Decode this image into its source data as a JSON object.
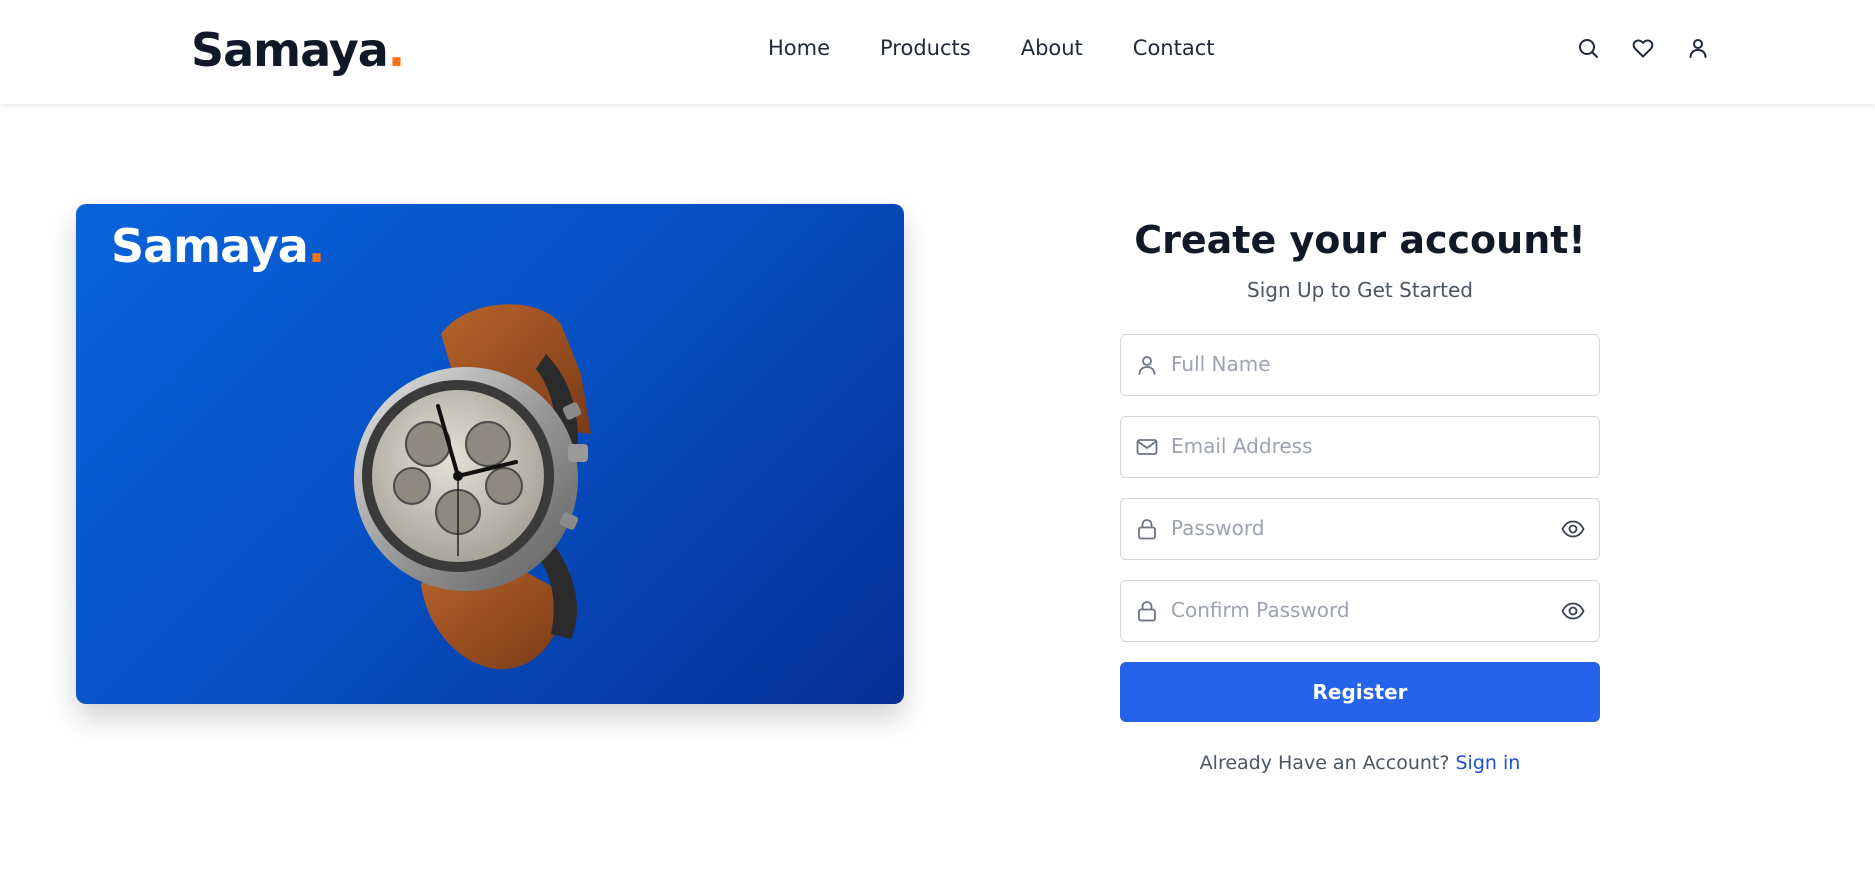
{
  "header": {
    "brand_name": "Samaya",
    "brand_dot": ".",
    "nav": [
      {
        "label": "Home"
      },
      {
        "label": "Products"
      },
      {
        "label": "About"
      },
      {
        "label": "Contact"
      }
    ],
    "icons": [
      "search-icon",
      "heart-icon",
      "user-icon"
    ]
  },
  "hero": {
    "brand_name": "Samaya",
    "brand_dot": ".",
    "image": "wristwatch-brown-leather-strap",
    "background_colors": [
      "#0a63da",
      "#062f95"
    ]
  },
  "form": {
    "title": "Create your account!",
    "subtitle": "Sign Up to Get Started",
    "fields": [
      {
        "placeholder": "Full Name",
        "value": "",
        "icon": "user-icon",
        "type": "text"
      },
      {
        "placeholder": "Email Address",
        "value": "",
        "icon": "mail-icon",
        "type": "email"
      },
      {
        "placeholder": "Password",
        "value": "",
        "icon": "lock-icon",
        "type": "password",
        "toggle_icon": "eye-icon"
      },
      {
        "placeholder": "Confirm Password",
        "value": "",
        "icon": "lock-icon",
        "type": "password",
        "toggle_icon": "eye-icon"
      }
    ],
    "submit_label": "Register",
    "footer_text": "Already Have an Account?",
    "footer_link": "Sign in"
  },
  "colors": {
    "accent": "#2563eb",
    "brand_dot": "#f97316",
    "link": "#1d4ed8"
  }
}
